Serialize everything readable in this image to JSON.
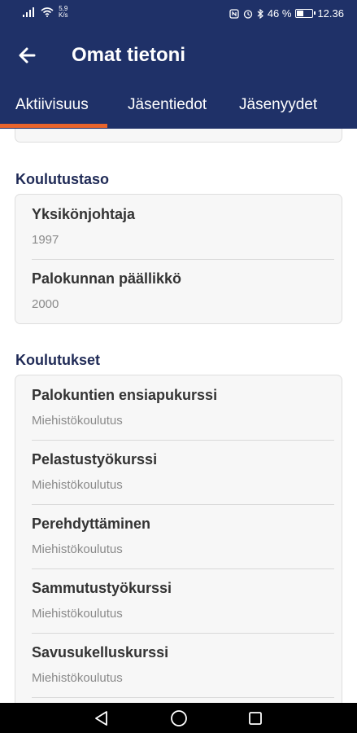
{
  "status_bar": {
    "net_speed_value": "5,9",
    "net_speed_unit": "K/s",
    "battery_percent": "46 %",
    "battery_level": 0.46,
    "time": "12.36"
  },
  "header": {
    "title": "Omat tietoni",
    "tabs": [
      {
        "label": "Aktiivisuus",
        "active": true
      },
      {
        "label": "Jäsentiedot",
        "active": false
      },
      {
        "label": "Jäsenyydet",
        "active": false
      }
    ],
    "accent_color": "#e8642c",
    "brand_color": "#1f3168"
  },
  "sections": {
    "education_level": {
      "title": "Koulutustaso",
      "items": [
        {
          "title": "Yksikönjohtaja",
          "subtitle": "1997"
        },
        {
          "title": "Palokunnan päällikkö",
          "subtitle": "2000"
        }
      ]
    },
    "trainings": {
      "title": "Koulutukset",
      "items": [
        {
          "title": "Palokuntien ensiapukurssi",
          "subtitle": "Miehistökoulutus"
        },
        {
          "title": "Pelastustyökurssi",
          "subtitle": "Miehistökoulutus"
        },
        {
          "title": "Perehdyttäminen",
          "subtitle": "Miehistökoulutus"
        },
        {
          "title": "Sammutustyökurssi",
          "subtitle": "Miehistökoulutus"
        },
        {
          "title": "Savusukelluskurssi",
          "subtitle": "Miehistökoulutus"
        }
      ]
    }
  },
  "icons": {
    "back": "arrow-left-icon",
    "nav_back": "triangle-back-icon",
    "nav_home": "circle-home-icon",
    "nav_recents": "square-recents-icon"
  }
}
